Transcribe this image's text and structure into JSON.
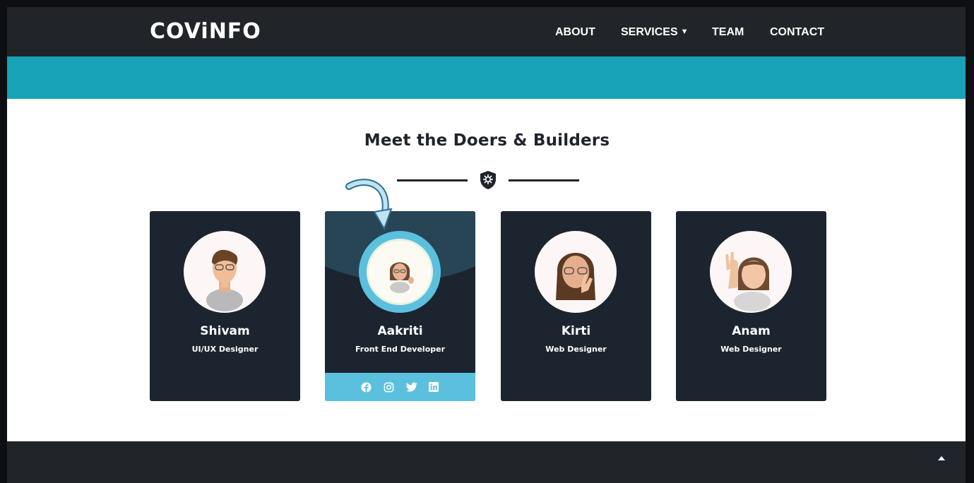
{
  "brand": {
    "logo_text": "COViNFO"
  },
  "nav": {
    "items": [
      {
        "label": "ABOUT"
      },
      {
        "label": "SERVICES"
      },
      {
        "label": "TEAM"
      },
      {
        "label": "CONTACT"
      }
    ]
  },
  "team": {
    "heading": "Meet the Doers & Builders",
    "members": [
      {
        "name": "Shivam",
        "role": "UI/UX Designer"
      },
      {
        "name": "Aakriti",
        "role": "Front End Developer"
      },
      {
        "name": "Kirti",
        "role": "Web Designer"
      },
      {
        "name": "Anam",
        "role": "Web Designer"
      }
    ],
    "social_icons": [
      "facebook-icon",
      "instagram-icon",
      "twitter-icon",
      "linkedin-icon"
    ]
  },
  "colors": {
    "topbar": "#212529",
    "band": "#17a2b8",
    "card": "#1c2430",
    "accent": "#5bc0de"
  }
}
